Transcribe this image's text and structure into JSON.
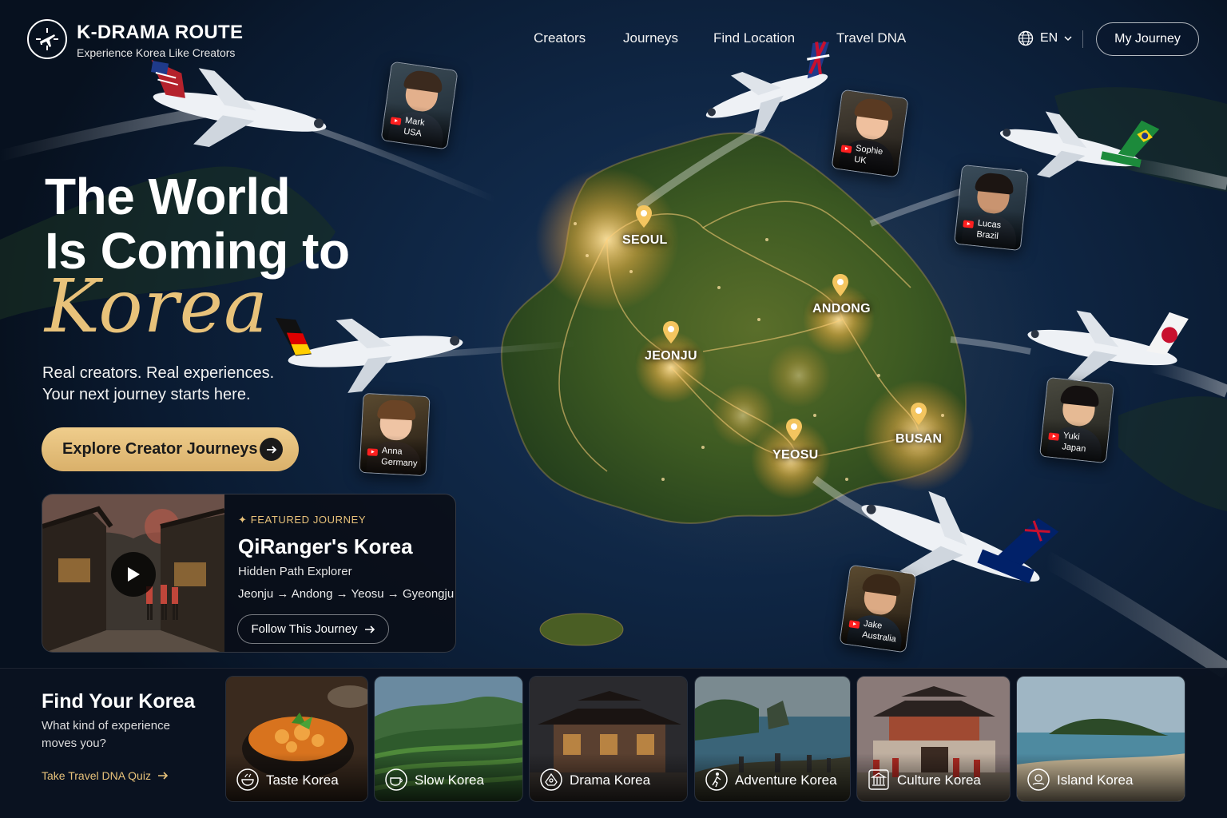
{
  "brand": {
    "title": "K-DRAMA ROUTE",
    "subtitle": "Experience Korea Like Creators"
  },
  "nav": {
    "items": [
      "Creators",
      "Journeys",
      "Find Location",
      "Travel DNA"
    ]
  },
  "language": {
    "label": "EN"
  },
  "my_journey_label": "My Journey",
  "hero": {
    "line1": "The World",
    "line2": "Is Coming to",
    "script": "Korea",
    "copy1": "Real creators. Real experiences.",
    "copy2": "Your next journey starts here.",
    "cta": "Explore Creator Journeys"
  },
  "featured": {
    "tag": "FEATURED JOURNEY",
    "title": "QiRanger's Korea",
    "subtitle": "Hidden Path Explorer",
    "route": "Jeonju → Andong → Yeosu → Gyeongju",
    "button": "Follow This Journey"
  },
  "cities": [
    "SEOUL",
    "ANDONG",
    "JEONJU",
    "BUSAN",
    "YEOSU"
  ],
  "creators": [
    {
      "name": "Mark",
      "country": "USA"
    },
    {
      "name": "Sophie",
      "country": "UK"
    },
    {
      "name": "Lucas",
      "country": "Brazil"
    },
    {
      "name": "Anna",
      "country": "Germany"
    },
    {
      "name": "Yuki",
      "country": "Japan"
    },
    {
      "name": "Jake",
      "country": "Australia"
    }
  ],
  "find": {
    "title": "Find Your Korea",
    "sub1": "What kind of experience",
    "sub2": "moves you?",
    "quiz": "Take Travel DNA Quiz"
  },
  "categories": [
    {
      "label": "Taste Korea",
      "icon": "bowl-icon"
    },
    {
      "label": "Slow Korea",
      "icon": "tea-cup-icon"
    },
    {
      "label": "Drama Korea",
      "icon": "clapper-icon"
    },
    {
      "label": "Adventure Korea",
      "icon": "hiker-icon"
    },
    {
      "label": "Culture Korea",
      "icon": "palace-icon"
    },
    {
      "label": "Island Korea",
      "icon": "island-icon"
    }
  ],
  "colors": {
    "accent": "#e8c27a",
    "ocean": "#0f2644",
    "land": "#3f5a22",
    "glow": "#ffd27a"
  }
}
